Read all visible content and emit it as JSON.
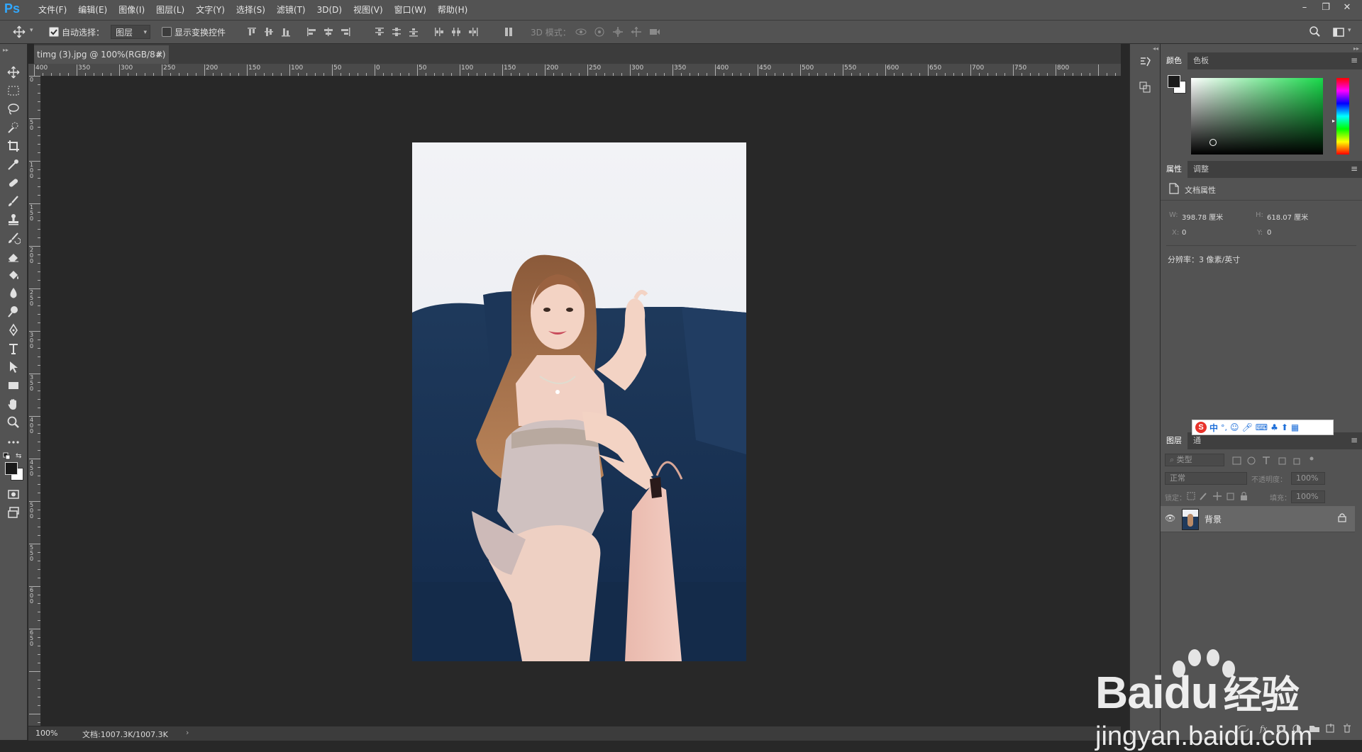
{
  "app": {
    "logo": "Ps"
  },
  "menu": [
    "文件(F)",
    "编辑(E)",
    "图像(I)",
    "图层(L)",
    "文字(Y)",
    "选择(S)",
    "滤镜(T)",
    "3D(D)",
    "视图(V)",
    "窗口(W)",
    "帮助(H)"
  ],
  "window_controls": {
    "minimize": "–",
    "restore": "❐",
    "close": "✕"
  },
  "options": {
    "auto_select_label": "自动选择：",
    "auto_select_checked": true,
    "target_value": "图层",
    "show_transform_label": "显示变换控件",
    "show_transform_checked": false,
    "mode_3d_label": "3D 模式："
  },
  "document_tab": {
    "title": "timg (3).jpg @ 100%(RGB/8#)",
    "close": "×"
  },
  "ruler": {
    "h_labels": [
      "400",
      "350",
      "300",
      "250",
      "200",
      "150",
      "100",
      "50",
      "0",
      "50",
      "100",
      "150",
      "200",
      "250",
      "300",
      "350",
      "400",
      "450",
      "500",
      "550",
      "600",
      "650",
      "700",
      "750",
      "800"
    ],
    "v_labels": [
      "0",
      "50",
      "100",
      "150",
      "200",
      "250",
      "300",
      "350",
      "400",
      "450",
      "500",
      "550",
      "600",
      "650"
    ]
  },
  "status": {
    "zoom": "100%",
    "doc": "文档:1007.3K/1007.3K",
    "arrow": "›"
  },
  "color_panel": {
    "tabs": [
      "颜色",
      "色板"
    ],
    "active": 0
  },
  "properties_panel": {
    "tabs": [
      "属性",
      "调整"
    ],
    "active": 0,
    "title": "文档属性",
    "w_label": "W:",
    "w_value": "398.78 厘米",
    "h_label": "H:",
    "h_value": "618.07 厘米",
    "x_label": "X:",
    "x_value": "0",
    "y_label": "Y:",
    "y_value": "0",
    "resolution": "分辨率：3 像素/英寸"
  },
  "layers_panel": {
    "tabs": [
      "图层",
      "通"
    ],
    "active": 0,
    "filter_placeholder": "类型",
    "blend_mode": "正常",
    "opacity_label": "不透明度：",
    "opacity_value": "100%",
    "lock_label": "锁定：",
    "fill_label": "填充：",
    "fill_value": "100%",
    "layers": [
      {
        "name": "背景",
        "visible": true,
        "locked": true
      }
    ]
  },
  "ime_toolbar": {
    "label": "中"
  },
  "watermark": {
    "brand": "Bai",
    "brand2": "du",
    "cn": "经验",
    "url": "jingyan.baidu.com"
  },
  "colors": {
    "accent": "#31a8ff",
    "fg_swatch": "#1a1a1a",
    "bg_swatch": "#ffffff",
    "green": "#18d94a"
  }
}
